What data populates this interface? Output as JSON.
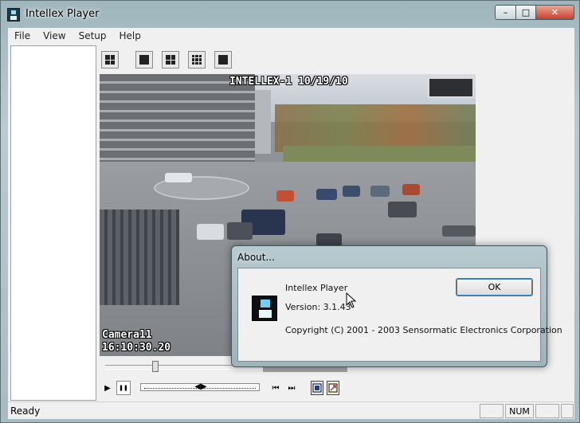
{
  "window": {
    "title": "Intellex Player",
    "icon": "intellex-app-icon",
    "caption_buttons": {
      "minimize": "–",
      "maximize": "□",
      "close": "✕"
    }
  },
  "menu": {
    "items": [
      {
        "label": "File"
      },
      {
        "label": "View"
      },
      {
        "label": "Setup"
      },
      {
        "label": "Help"
      }
    ]
  },
  "toolbar": {
    "layouts": [
      "layout-2x2-icon",
      "layout-1x1-icon",
      "layout-2x2-icon",
      "layout-3x3-icon",
      "layout-4x4-icon"
    ]
  },
  "video": {
    "header_overlay": "INTELLEX-1 10/19/10",
    "camera_label": "Camera11",
    "timestamp": "16:10:30.20"
  },
  "playback": {
    "play_glyph": "▶",
    "pause_glyph": "❚❚",
    "speed_glyph": "◀▶",
    "frame_back_glyph": "⏮",
    "frame_forward_glyph": "⏭"
  },
  "status": {
    "text": "Ready",
    "indicator_num": "NUM"
  },
  "about_dialog": {
    "title": "About...",
    "product": "Intellex Player",
    "version": "Version: 3.1.43",
    "copyright": "Copyright (C) 2001 - 2003 Sensormatic Electronics Corporation",
    "ok_label": "OK"
  }
}
